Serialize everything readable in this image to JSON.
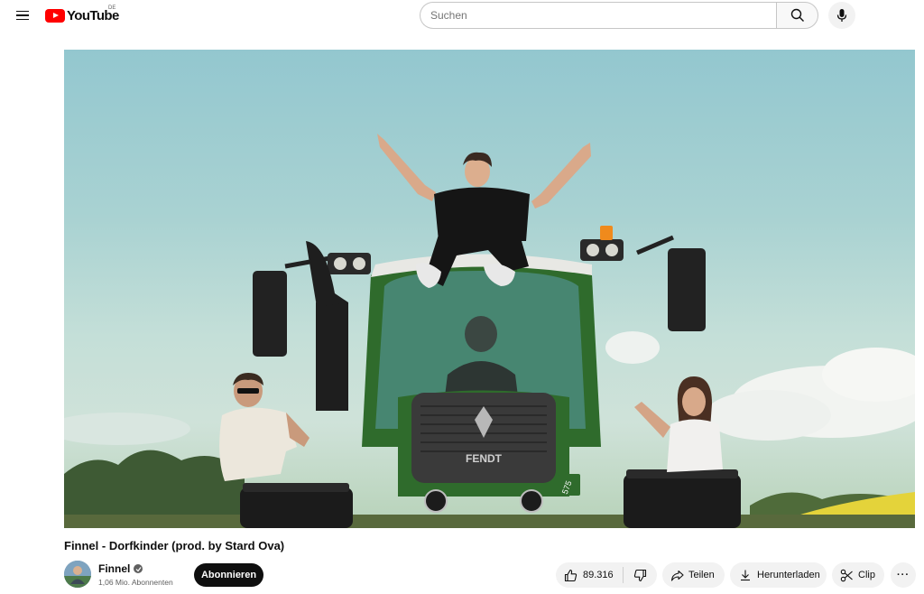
{
  "header": {
    "logo_text": "YouTube",
    "country_code": "DE",
    "search_placeholder": "Suchen"
  },
  "video": {
    "title": "Finnel - Dorfkinder (prod. by Stard Ova)",
    "scene": {
      "tractor_plate": "575",
      "tractor_brand": "FENDT"
    }
  },
  "channel": {
    "name": "Finnel",
    "subscribers": "1,06 Mio. Abonnenten",
    "subscribe_label": "Abonnieren"
  },
  "actions": {
    "like_count": "89.316",
    "share_label": "Teilen",
    "download_label": "Herunterladen",
    "clip_label": "Clip",
    "more_label": "···"
  },
  "icons": [
    "menu-icon",
    "youtube-logo-icon",
    "search-icon",
    "mic-icon",
    "verified-icon",
    "thumbs-up-icon",
    "thumbs-down-icon",
    "share-icon",
    "download-icon",
    "scissors-icon",
    "more-icon"
  ],
  "colors": {
    "brand_red": "#ff0000",
    "subscribe_bg": "#0f0f0f",
    "pill_bg": "#f2f2f2",
    "tractor_green": "#2f6b2c"
  }
}
